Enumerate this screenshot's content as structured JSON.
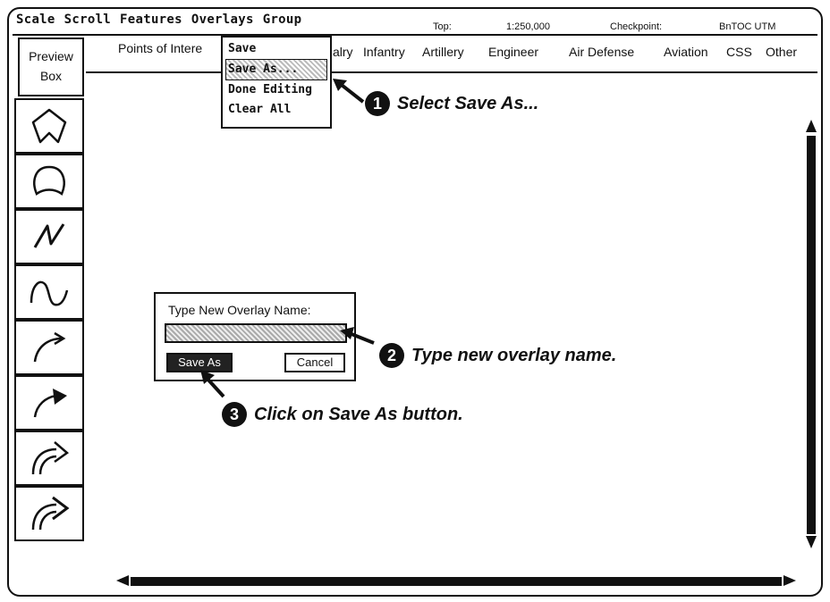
{
  "menubar": {
    "items": [
      "Scale",
      "Scroll",
      "Features",
      "Overlays",
      "Group"
    ]
  },
  "status": {
    "top_label": "Top:",
    "scale": "1:250,000",
    "checkpoint_label": "Checkpoint:",
    "checkpoint_value": "BnTOC UTM"
  },
  "preview_box": {
    "label_line1": "Preview",
    "label_line2": "Box"
  },
  "categories": [
    "Points of Intere",
    "alry",
    "Infantry",
    "Artillery",
    "Engineer",
    "Air Defense",
    "Aviation",
    "CSS",
    "Other"
  ],
  "overlays_menu": {
    "items": [
      "Save",
      "Save As...",
      "Done Editing",
      "Clear All"
    ],
    "highlighted_index": 1
  },
  "palette": {
    "tools": [
      "pentagon-shape-icon",
      "closed-curve-icon",
      "zigzag-line-icon",
      "sine-curve-icon",
      "curved-arrow-icon",
      "curved-filled-arrow-icon",
      "double-curved-arrow-icon",
      "double-curved-arrow-alt-icon"
    ]
  },
  "dialog": {
    "label": "Type New Overlay Name:",
    "input_value": "",
    "save_as_label": "Save As",
    "cancel_label": "Cancel"
  },
  "annotations": {
    "step1": {
      "num": "1",
      "text": "Select Save As..."
    },
    "step2": {
      "num": "2",
      "text": "Type new overlay name."
    },
    "step3": {
      "num": "3",
      "text": "Click on Save As button."
    }
  }
}
